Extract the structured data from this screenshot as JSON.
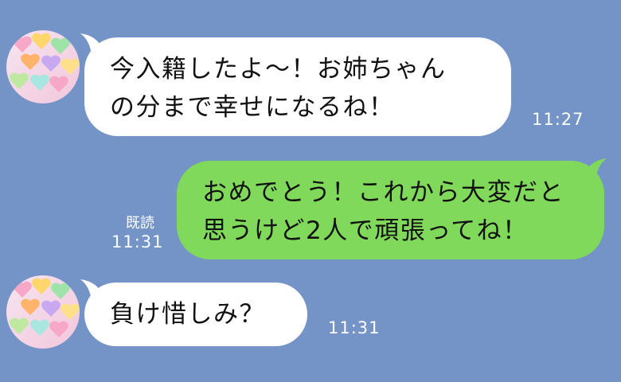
{
  "colors": {
    "background": "#7494c8",
    "incoming_bubble": "#ffffff",
    "outgoing_bubble": "#80d95a",
    "meta_text": "#ffffff"
  },
  "messages": [
    {
      "direction": "incoming",
      "avatar": "candy-hearts-avatar",
      "lines": [
        "今入籍したよ～！お姉ちゃん",
        "の分まで幸せになるね！"
      ],
      "time": "11:27"
    },
    {
      "direction": "outgoing",
      "lines": [
        "おめでとう！これから大変だと",
        "思うけど2人で頑張ってね！"
      ],
      "read_label": "既読",
      "time": "11:31"
    },
    {
      "direction": "incoming",
      "avatar": "candy-hearts-avatar",
      "lines": [
        "負け惜しみ？"
      ],
      "time": "11:31"
    }
  ]
}
